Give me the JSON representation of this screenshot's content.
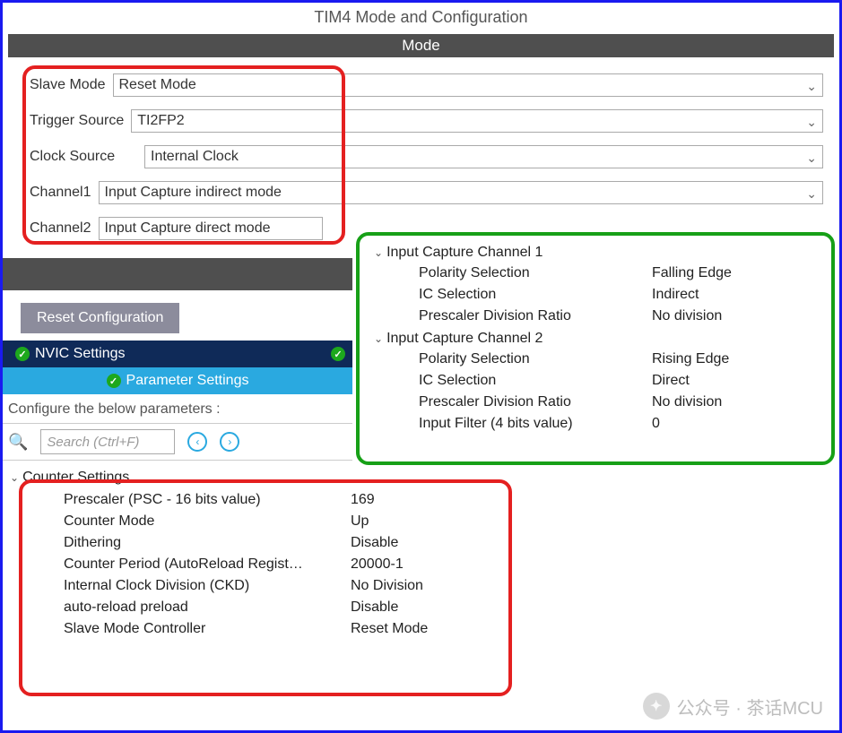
{
  "title": "TIM4 Mode and Configuration",
  "mode_bar": "Mode",
  "mode": {
    "slave_mode": {
      "label": "Slave Mode",
      "value": "Reset Mode"
    },
    "trigger_source": {
      "label": "Trigger Source",
      "value": "TI2FP2"
    },
    "clock_source": {
      "label": "Clock Source",
      "value": "Internal Clock"
    },
    "channel1": {
      "label": "Channel1",
      "value": "Input Capture indirect mode"
    },
    "channel2": {
      "label": "Channel2",
      "value": "Input Capture direct mode"
    }
  },
  "reset_btn": "Reset Configuration",
  "tabs": {
    "nvic": "NVIC Settings",
    "param": "Parameter Settings"
  },
  "configure_text": "Configure the below parameters :",
  "search_placeholder": "Search (Ctrl+F)",
  "counter": {
    "header": "Counter Settings",
    "rows": [
      {
        "label": "Prescaler (PSC - 16 bits value)",
        "value": "169"
      },
      {
        "label": "Counter Mode",
        "value": "Up"
      },
      {
        "label": "Dithering",
        "value": "Disable"
      },
      {
        "label": "Counter Period (AutoReload Regist…",
        "value": "20000-1"
      },
      {
        "label": "Internal Clock Division (CKD)",
        "value": "No Division"
      },
      {
        "label": "auto-reload preload",
        "value": "Disable"
      },
      {
        "label": "Slave Mode Controller",
        "value": "Reset Mode"
      }
    ]
  },
  "ic": {
    "ch1": {
      "header": "Input Capture Channel 1",
      "rows": [
        {
          "label": "Polarity Selection",
          "value": "Falling Edge"
        },
        {
          "label": "IC Selection",
          "value": "Indirect"
        },
        {
          "label": "Prescaler Division Ratio",
          "value": "No division"
        }
      ]
    },
    "ch2": {
      "header": "Input Capture Channel 2",
      "rows": [
        {
          "label": "Polarity Selection",
          "value": "Rising Edge"
        },
        {
          "label": "IC Selection",
          "value": "Direct"
        },
        {
          "label": "Prescaler Division Ratio",
          "value": "No division"
        },
        {
          "label": "Input Filter (4 bits value)",
          "value": "0"
        }
      ]
    }
  },
  "watermark": "公众号 · 茶话MCU"
}
